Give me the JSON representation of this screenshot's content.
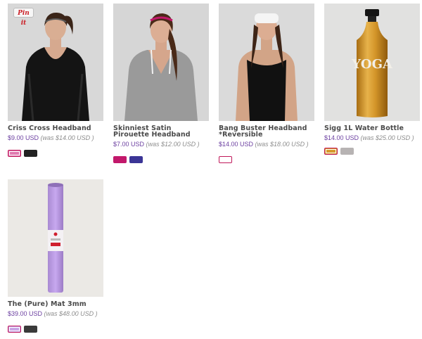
{
  "products": [
    {
      "name": "Criss Cross Headband",
      "price": "$9.00 USD",
      "was": "(was $14.00 USD )",
      "pin_label": "Pin it",
      "image_icon": "model-with-headband-photo",
      "swatches": [
        {
          "color": "#e07ab0",
          "selected": true
        },
        {
          "color": "#222222",
          "selected": false
        }
      ]
    },
    {
      "name": "Skinniest Satin Pirouette Headband",
      "price": "$7.00 USD",
      "was": "(was $12.00 USD )",
      "image_icon": "model-with-headband-photo",
      "swatches": [
        {
          "color": "#c2186b",
          "selected": false
        },
        {
          "color": "#3b3596",
          "selected": false
        }
      ]
    },
    {
      "name": "Bang Buster Headband *Reversible",
      "price": "$14.00 USD",
      "was": "(was $18.00 USD )",
      "image_icon": "model-with-headband-photo",
      "swatches": [
        {
          "color": "#ffffff",
          "selected": true
        }
      ]
    },
    {
      "name": "Sigg 1L Water Bottle",
      "price": "$14.00 USD",
      "was": "(was $25.00 USD )",
      "image_icon": "water-bottle-photo",
      "bottle_text": "YOGA",
      "swatches": [
        {
          "color": "#d79a2b",
          "selected": true
        },
        {
          "color": "#b7b3b3",
          "selected": false
        }
      ]
    },
    {
      "name": "The (Pure) Mat 3mm",
      "price": "$39.00 USD",
      "was": "(was $48.00 USD )",
      "image_icon": "yoga-mat-photo",
      "swatches": [
        {
          "color": "#c9a6e6",
          "selected": true
        },
        {
          "color": "#3a3a3a",
          "selected": false
        }
      ]
    }
  ]
}
